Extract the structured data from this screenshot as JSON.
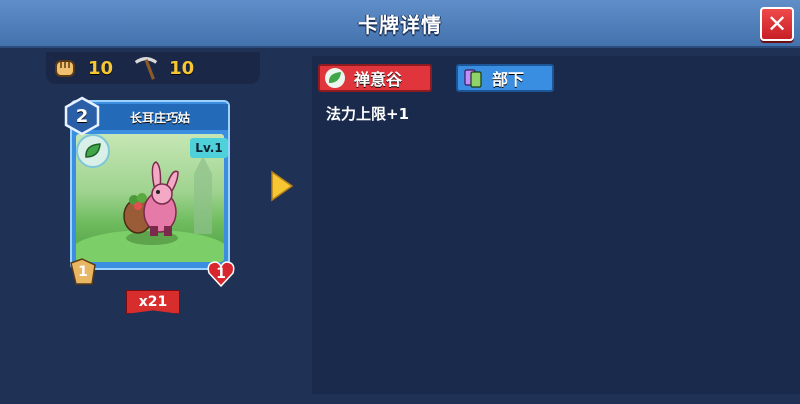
{
  "header": {
    "title": "卡牌详情"
  },
  "resources": [
    {
      "icon": "fist-icon",
      "value": "10"
    },
    {
      "icon": "pickaxe-icon",
      "value": "10"
    }
  ],
  "card": {
    "name": "长耳庄巧姑",
    "level": "2",
    "lv_label": "Lv.1",
    "attack": "1",
    "health": "1",
    "count": "x21"
  },
  "details": {
    "element_tag": "禅意谷",
    "type_tag": "部下",
    "effect": "法力上限+1"
  },
  "colors": {
    "accent_red": "#e0353d",
    "accent_blue": "#3a8ee1",
    "resource_gold": "#f6c733"
  }
}
